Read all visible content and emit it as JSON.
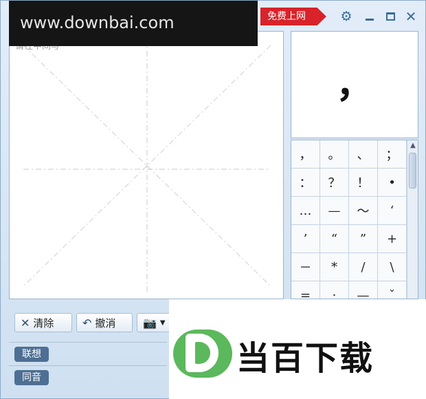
{
  "titlebar": {
    "promo_label": "免费上网",
    "icons": {
      "settings": "gear-icon",
      "minimize": "minimize-icon",
      "maximize": "maximize-icon",
      "close": "close-icon"
    }
  },
  "watermark_top": "www.downbai.com",
  "pad": {
    "hint": "请在中间写"
  },
  "toolbar": {
    "clear_label": "清除",
    "undo_label": "撤消",
    "camera_icon": "camera-icon"
  },
  "tags": [
    {
      "label": "联想"
    },
    {
      "label": "同音"
    }
  ],
  "preview": {
    "char": "，"
  },
  "candidates": [
    "，",
    "。",
    "、",
    "；",
    "：",
    "？",
    "！",
    "•",
    "…",
    "—",
    "～",
    "‘",
    "’",
    "“",
    "”",
    "+",
    "－",
    "*",
    "/",
    "\\",
    "=",
    "·",
    "—",
    "ˇ"
  ],
  "brand": {
    "text": "当百下载"
  },
  "colors": {
    "promo": "#d8232a",
    "tag": "#4d6f93",
    "logo": "#5cb85c"
  }
}
